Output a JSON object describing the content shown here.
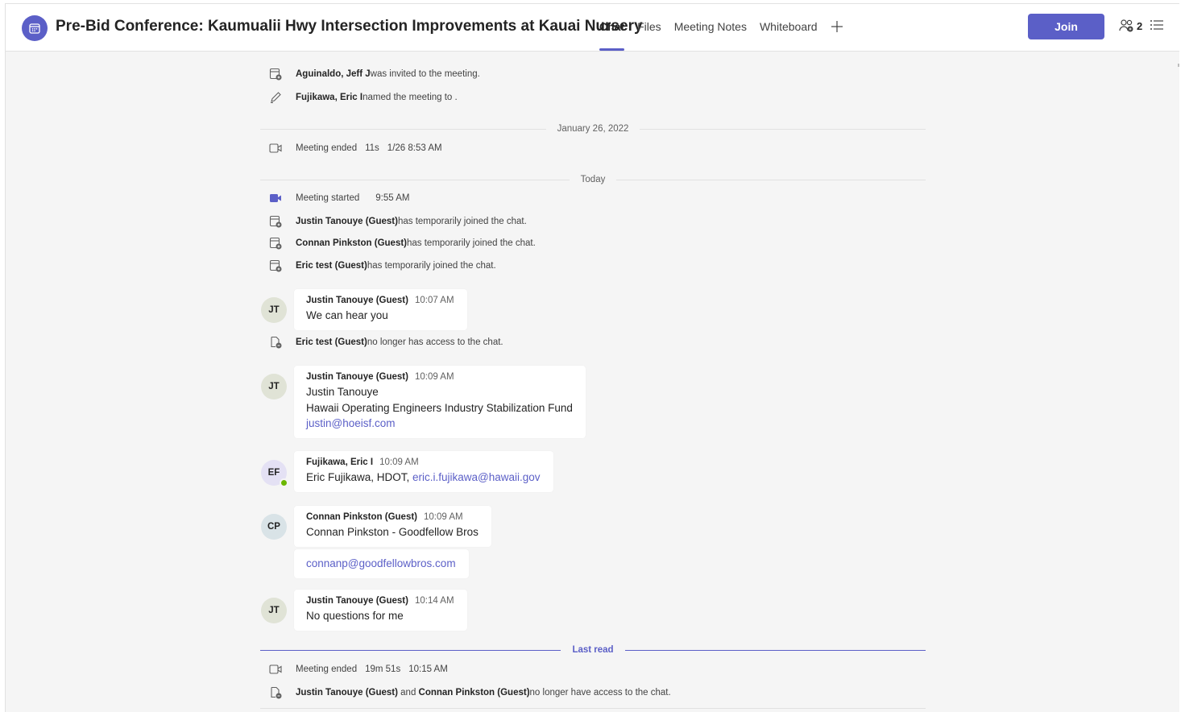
{
  "header": {
    "title": "Pre-Bid Conference: Kaumualii Hwy Intersection Improvements at Kauai Nursery",
    "tabs": [
      {
        "label": "Chat",
        "active": true
      },
      {
        "label": "Files",
        "active": false
      },
      {
        "label": "Meeting Notes",
        "active": false
      },
      {
        "label": "Whiteboard",
        "active": false
      }
    ],
    "join_label": "Join",
    "participant_count": "2",
    "accent_color": "#5b5fc7"
  },
  "events": {
    "e1": {
      "name": "Aguinaldo, Jeff J",
      "text": " was invited to the meeting."
    },
    "e2": {
      "name": "Fujikawa, Eric I",
      "text": " named the meeting to ."
    },
    "date1": "January 26, 2022",
    "e3": {
      "text": "Meeting ended",
      "duration": "11s",
      "time": "1/26 8:53 AM"
    },
    "date2": "Today",
    "e4": {
      "text": "Meeting started",
      "time": "9:55 AM"
    },
    "e5": {
      "name": "Justin Tanouye (Guest)",
      "text": " has temporarily joined the chat."
    },
    "e6": {
      "name": "Connan Pinkston (Guest)",
      "text": " has temporarily joined the chat."
    },
    "e7": {
      "name": "Eric test (Guest)",
      "text": " has temporarily joined the chat."
    },
    "e8": {
      "name": "Eric test (Guest)",
      "text": " no longer has access to the chat."
    },
    "last_read": "Last read",
    "e9": {
      "text": "Meeting ended",
      "duration": "19m 51s",
      "time": "10:15 AM"
    },
    "e10": {
      "name1": "Justin Tanouye (Guest)",
      "and": " and ",
      "name2": "Connan Pinkston (Guest)",
      "text": " no longer have access to the chat."
    }
  },
  "messages": {
    "m1": {
      "initials": "JT",
      "sender": "Justin Tanouye (Guest)",
      "time": "10:07 AM",
      "lines": [
        "We can hear you"
      ]
    },
    "m2": {
      "initials": "JT",
      "sender": "Justin Tanouye (Guest)",
      "time": "10:09 AM",
      "lines": [
        "Justin Tanouye",
        "Hawaii Operating Engineers Industry Stabilization Fund"
      ],
      "link": "justin@hoeisf.com"
    },
    "m3": {
      "initials": "EF",
      "sender": "Fujikawa, Eric I",
      "time": "10:09 AM",
      "text": "Eric Fujikawa, HDOT, ",
      "link": "eric.i.fujikawa@hawaii.gov"
    },
    "m4": {
      "initials": "CP",
      "sender": "Connan Pinkston (Guest)",
      "time": "10:09 AM",
      "lines": [
        "Connan Pinkston - Goodfellow Bros"
      ],
      "link": "connanp@goodfellowbros.com"
    },
    "m5": {
      "initials": "JT",
      "sender": "Justin Tanouye (Guest)",
      "time": "10:14 AM",
      "lines": [
        "No questions for me"
      ]
    }
  }
}
